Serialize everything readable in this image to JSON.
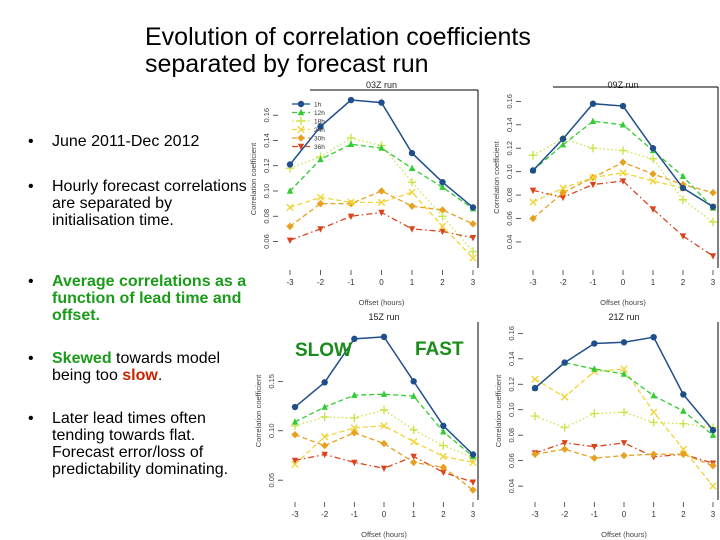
{
  "slide": {
    "title_line1": "Evolution of correlation coefficients",
    "title_line2": "separated by forecast run",
    "bullets": [
      {
        "parts": [
          {
            "text": "June 2011-Dec 2012",
            "style": ""
          }
        ]
      },
      {
        "parts": [
          {
            "text": "Hourly forecast correlations are separated by initialisation time.",
            "style": ""
          }
        ]
      },
      {
        "parts": [
          {
            "text": "Average correlations as a function of lead time and offset.",
            "style": "green"
          }
        ]
      },
      {
        "parts": [
          {
            "text": "Skewed",
            "style": "green"
          },
          {
            "text": " towards model being too ",
            "style": ""
          },
          {
            "text": "slow",
            "style": "red"
          },
          {
            "text": ".",
            "style": ""
          }
        ]
      },
      {
        "parts": [
          {
            "text": "Later lead times often tending towards flat. Forecast error/loss of predictability dominating.",
            "style": ""
          }
        ]
      }
    ],
    "bullet_glyph": "•",
    "slow_label": "SLOW",
    "fast_label": "FAST"
  },
  "series_style": [
    {
      "name": "1h",
      "color": "#1f4e8c",
      "marker": "circle",
      "dash": "solid"
    },
    {
      "name": "12h",
      "color": "#33cc33",
      "marker": "triangle-up",
      "dash": "dashed"
    },
    {
      "name": "18h",
      "color": "#c8e64a",
      "marker": "plus",
      "dash": "dotted"
    },
    {
      "name": "24h",
      "color": "#f0d43a",
      "marker": "cross",
      "dash": "dashed"
    },
    {
      "name": "30h",
      "color": "#e8a020",
      "marker": "diamond",
      "dash": "dashed"
    },
    {
      "name": "36h",
      "color": "#d9441c",
      "marker": "triangle-down",
      "dash": "dotdash"
    }
  ],
  "chart_data": [
    {
      "type": "line",
      "title": "03Z run",
      "xlabel": "Offset (hours)",
      "ylabel": "Correlation coefficient",
      "x": [
        -3,
        -2,
        -1,
        0,
        1,
        2,
        3
      ],
      "ylim": [
        0.043,
        0.176
      ],
      "yticks": [
        0.06,
        0.08,
        0.1,
        0.12,
        0.14,
        0.16
      ],
      "legend": "top-left",
      "grid": false,
      "series": [
        {
          "name": "1h",
          "values": [
            0.121,
            0.151,
            0.172,
            0.17,
            0.13,
            0.107,
            0.087
          ]
        },
        {
          "name": "12h",
          "values": [
            0.1,
            0.125,
            0.137,
            0.134,
            0.118,
            0.103,
            0.086
          ]
        },
        {
          "name": "18h",
          "values": [
            0.118,
            0.127,
            0.142,
            0.136,
            0.107,
            0.08,
            0.052
          ]
        },
        {
          "name": "24h",
          "values": [
            0.087,
            0.095,
            0.091,
            0.091,
            0.099,
            0.072,
            0.047
          ]
        },
        {
          "name": "30h",
          "values": [
            0.072,
            0.09,
            0.09,
            0.1,
            0.088,
            0.085,
            0.074
          ]
        },
        {
          "name": "36h",
          "values": [
            0.061,
            0.07,
            0.08,
            0.083,
            0.07,
            0.068,
            0.063
          ]
        }
      ]
    },
    {
      "type": "line",
      "title": "09Z run",
      "xlabel": "Offset (hours)",
      "ylabel": "Correlation coefficient",
      "x": [
        -3,
        -2,
        -1,
        0,
        1,
        2,
        3
      ],
      "ylim": [
        0.022,
        0.168
      ],
      "yticks": [
        0.04,
        0.06,
        0.08,
        0.1,
        0.12,
        0.14,
        0.16
      ],
      "grid": false,
      "series": [
        {
          "name": "1h",
          "values": [
            0.101,
            0.128,
            0.158,
            0.156,
            0.12,
            0.086,
            0.07
          ]
        },
        {
          "name": "12h",
          "values": [
            0.101,
            0.123,
            0.143,
            0.14,
            0.118,
            0.096,
            0.069
          ]
        },
        {
          "name": "18h",
          "values": [
            0.114,
            0.128,
            0.12,
            0.118,
            0.111,
            0.076,
            0.057
          ]
        },
        {
          "name": "24h",
          "values": [
            0.074,
            0.086,
            0.095,
            0.099,
            0.092,
            0.086,
            0.07
          ]
        },
        {
          "name": "30h",
          "values": [
            0.06,
            0.082,
            0.095,
            0.108,
            0.098,
            0.089,
            0.082
          ]
        },
        {
          "name": "36h",
          "values": [
            0.084,
            0.078,
            0.089,
            0.092,
            0.068,
            0.045,
            0.028
          ]
        }
      ]
    },
    {
      "type": "line",
      "title": "15Z run",
      "xlabel": "Offset (hours)",
      "ylabel": "Correlation coefficient",
      "x": [
        -3,
        -2,
        -1,
        0,
        1,
        2,
        3
      ],
      "ylim": [
        0.035,
        0.205
      ],
      "yticks": [
        0.05,
        0.1,
        0.15
      ],
      "grid": false,
      "series": [
        {
          "name": "1h",
          "values": [
            0.124,
            0.149,
            0.193,
            0.195,
            0.15,
            0.105,
            0.076
          ]
        },
        {
          "name": "12h",
          "values": [
            0.109,
            0.124,
            0.136,
            0.137,
            0.135,
            0.099,
            0.074
          ]
        },
        {
          "name": "18h",
          "values": [
            0.105,
            0.114,
            0.113,
            0.121,
            0.101,
            0.085,
            0.073
          ]
        },
        {
          "name": "24h",
          "values": [
            0.066,
            0.094,
            0.103,
            0.105,
            0.089,
            0.074,
            0.068
          ]
        },
        {
          "name": "30h",
          "values": [
            0.096,
            0.085,
            0.098,
            0.087,
            0.068,
            0.063,
            0.04
          ]
        },
        {
          "name": "36h",
          "values": [
            0.07,
            0.076,
            0.068,
            0.062,
            0.074,
            0.058,
            0.048
          ]
        }
      ]
    },
    {
      "type": "line",
      "title": "21Z run",
      "xlabel": "Offset (hours)",
      "ylabel": "Correlation coefficient",
      "x": [
        -3,
        -2,
        -1,
        0,
        1,
        2,
        3
      ],
      "ylim": [
        0.033,
        0.165
      ],
      "yticks": [
        0.04,
        0.06,
        0.08,
        0.1,
        0.12,
        0.14,
        0.16
      ],
      "grid": false,
      "series": [
        {
          "name": "1h",
          "values": [
            0.117,
            0.137,
            0.152,
            0.153,
            0.157,
            0.112,
            0.084
          ]
        },
        {
          "name": "12h",
          "values": [
            0.117,
            0.137,
            0.132,
            0.128,
            0.111,
            0.099,
            0.08
          ]
        },
        {
          "name": "18h",
          "values": [
            0.095,
            0.086,
            0.097,
            0.098,
            0.09,
            0.089,
            0.086
          ]
        },
        {
          "name": "24h",
          "values": [
            0.124,
            0.11,
            0.13,
            0.132,
            0.098,
            0.069,
            0.04
          ]
        },
        {
          "name": "30h",
          "values": [
            0.065,
            0.069,
            0.062,
            0.064,
            0.065,
            0.065,
            0.056
          ]
        },
        {
          "name": "36h",
          "values": [
            0.066,
            0.074,
            0.071,
            0.074,
            0.063,
            0.065,
            0.058
          ]
        }
      ]
    }
  ]
}
